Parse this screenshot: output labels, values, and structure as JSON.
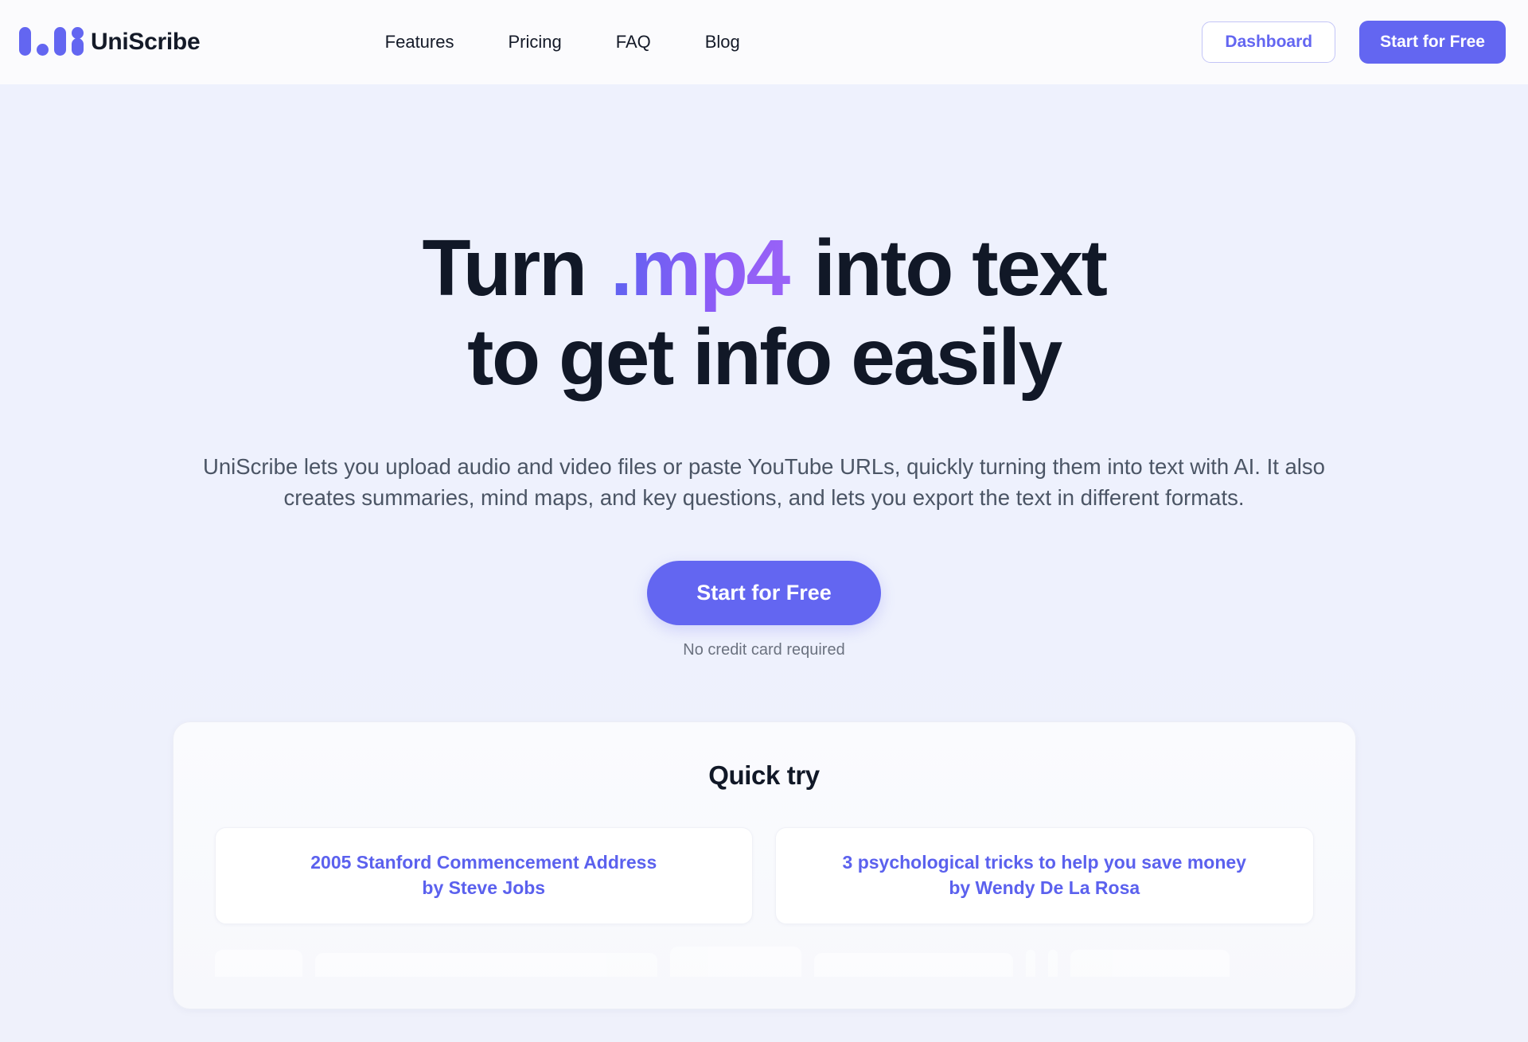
{
  "header": {
    "brand": {
      "name": "UniScribe",
      "logo_icon": "uniscribe-waveform-logo"
    },
    "nav": [
      {
        "label": "Features"
      },
      {
        "label": "Pricing"
      },
      {
        "label": "FAQ"
      },
      {
        "label": "Blog"
      }
    ],
    "dashboard_label": "Dashboard",
    "start_label": "Start for Free"
  },
  "hero": {
    "headline_part1": "Turn",
    "headline_ext": ".mp4",
    "headline_part2": "into text",
    "headline_line2": "to get info easily",
    "subtitle": "UniScribe lets you upload audio and video files or paste YouTube URLs, quickly turning them into text with AI. It also creates summaries, mind maps, and key questions, and lets you export the text in different formats.",
    "cta_label": "Start for Free",
    "cta_note": "No credit card required"
  },
  "quick_try": {
    "title": "Quick try",
    "items": [
      {
        "line1": "2005 Stanford Commencement Address",
        "line2": "by Steve Jobs"
      },
      {
        "line1": "3 psychological tricks to help you save money",
        "line2": "by Wendy De La Rosa"
      }
    ]
  },
  "colors": {
    "brand_purple": "#6366f1",
    "accent_violet": "#8b5cf6",
    "link_purple": "#5b61ee",
    "ink": "#111827",
    "muted": "#4b5565",
    "hero_bg": "#eef1fd"
  }
}
